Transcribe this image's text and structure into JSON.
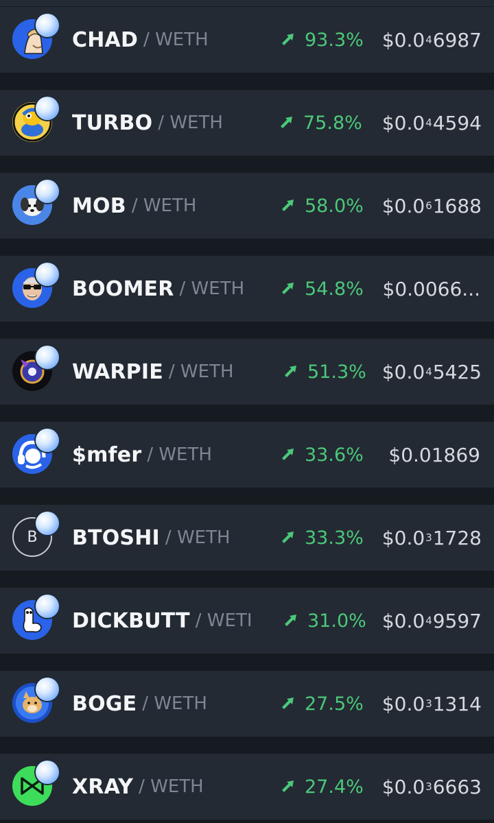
{
  "pair_quote": "/ WETH",
  "pair_quote_truncated": "/ WETI",
  "accent_colors": {
    "gain": "#4cc87a",
    "row_bg": "#232a33",
    "page_bg": "#161b21"
  },
  "tokens": [
    {
      "symbol": "CHAD",
      "change": "93.3%",
      "price_prefix": "$0.0",
      "price_sub": "4",
      "price_rest": "6987",
      "icon": "chad-avatar-icon"
    },
    {
      "symbol": "TURBO",
      "change": "75.8%",
      "price_prefix": "$0.0",
      "price_sub": "4",
      "price_rest": "4594",
      "icon": "turbo-toad-icon"
    },
    {
      "symbol": "MOB",
      "change": "58.0%",
      "price_prefix": "$0.0",
      "price_sub": "6",
      "price_rest": "1688",
      "icon": "mob-dog-icon"
    },
    {
      "symbol": "BOOMER",
      "change": "54.8%",
      "price_prefix": "$0.0066...",
      "price_sub": "",
      "price_rest": "",
      "icon": "boomer-sunglasses-icon"
    },
    {
      "symbol": "WARPIE",
      "change": "51.3%",
      "price_prefix": "$0.0",
      "price_sub": "4",
      "price_rest": "5425",
      "icon": "warpie-icon"
    },
    {
      "symbol": "$mfer",
      "change": "33.6%",
      "price_prefix": "$0.01869",
      "price_sub": "",
      "price_rest": "",
      "icon": "mfer-headphones-icon"
    },
    {
      "symbol": "BTOSHI",
      "change": "33.3%",
      "price_prefix": "$0.0",
      "price_sub": "3",
      "price_rest": "1728",
      "icon": "btoshi-letter-icon",
      "icon_letter": "B"
    },
    {
      "symbol": "DICKBUTT",
      "change": "31.0%",
      "price_prefix": "$0.0",
      "price_sub": "4",
      "price_rest": "9597",
      "icon": "dickbutt-drawing-icon"
    },
    {
      "symbol": "BOGE",
      "change": "27.5%",
      "price_prefix": "$0.0",
      "price_sub": "3",
      "price_rest": "1314",
      "icon": "boge-doge-icon"
    },
    {
      "symbol": "XRAY",
      "change": "27.4%",
      "price_prefix": "$0.0",
      "price_sub": "3",
      "price_rest": "6663",
      "icon": "xray-bowtie-icon"
    }
  ]
}
